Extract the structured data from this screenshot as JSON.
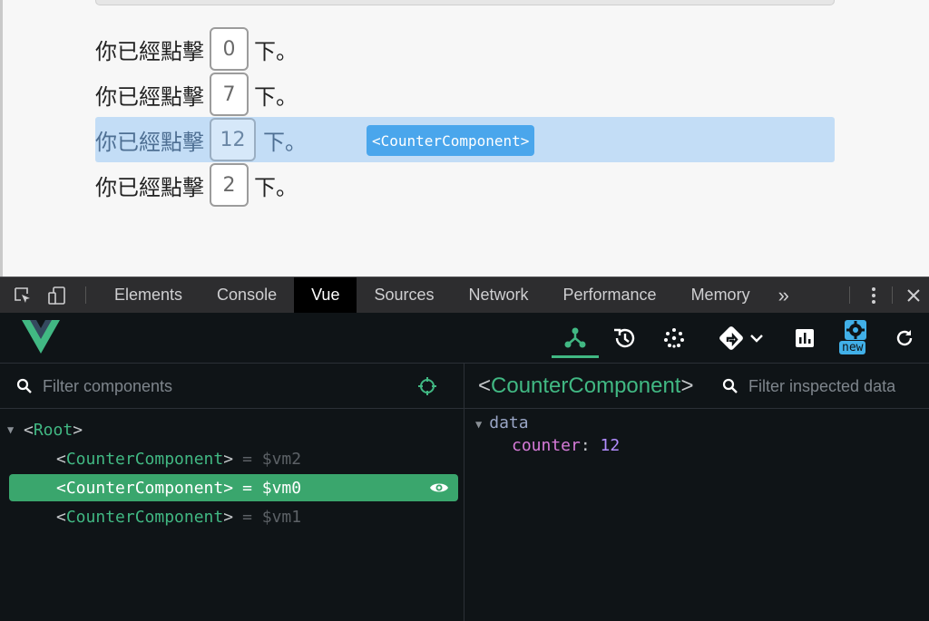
{
  "page": {
    "rows": [
      {
        "prefix": "你已經點擊",
        "count": "0",
        "suffix": "下。"
      },
      {
        "prefix": "你已經點擊",
        "count": "7",
        "suffix": "下。"
      },
      {
        "prefix": "你已經點擊",
        "count": "12",
        "suffix": "下。"
      },
      {
        "prefix": "你已經點擊",
        "count": "2",
        "suffix": "下。"
      }
    ],
    "highlight_tag": "<CounterComponent>"
  },
  "devtools": {
    "tabs": [
      "Elements",
      "Console",
      "Vue",
      "Sources",
      "Network",
      "Performance",
      "Memory"
    ],
    "active_tab": "Vue",
    "more_label": "»"
  },
  "vue": {
    "new_badge": "new",
    "filter_components_placeholder": "Filter components",
    "filter_data_placeholder": "Filter inspected data",
    "tree": {
      "root": {
        "open": "<",
        "name": "Root",
        "close": ">"
      },
      "children": [
        {
          "open": "<",
          "name": "CounterComponent",
          "close": ">",
          "ref": "= $vm2"
        },
        {
          "open": "<",
          "name": "CounterComponent",
          "close": ">",
          "ref": "= $vm0"
        },
        {
          "open": "<",
          "name": "CounterComponent",
          "close": ">",
          "ref": "= $vm1"
        }
      ]
    },
    "inspector": {
      "open": "<",
      "name": "CounterComponent",
      "close": ">",
      "section": "data",
      "key": "counter",
      "colon": ":",
      "value": "12"
    }
  },
  "colors": {
    "vue_green": "#41b883",
    "selection_green": "#3aa66d",
    "highlight_blue": "#c3ddf6",
    "overlay_blue": "#4aa6ec",
    "panel_bg": "#0f1417"
  },
  "icons": [
    "inspect-element-icon",
    "device-toggle-icon",
    "more-options-icon",
    "close-icon",
    "vue-logo-icon",
    "components-tree-icon",
    "history-icon",
    "vuex-icon",
    "router-icon",
    "performance-chart-icon",
    "settings-gear-icon",
    "refresh-icon",
    "search-icon",
    "target-icon",
    "eye-icon"
  ]
}
